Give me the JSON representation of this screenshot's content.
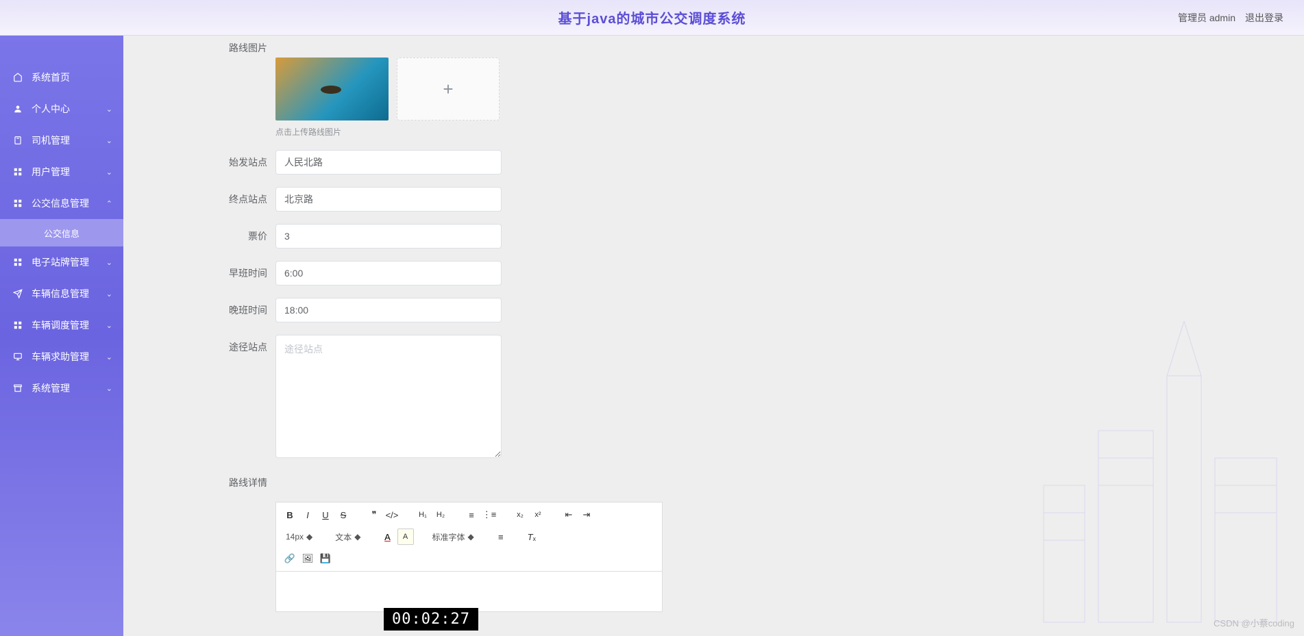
{
  "header": {
    "title": "基于java的城市公交调度系统",
    "role_label": "管理员 admin",
    "logout_label": "退出登录"
  },
  "sidebar": {
    "items": [
      {
        "icon": "home",
        "label": "系统首页",
        "expandable": false
      },
      {
        "icon": "person",
        "label": "个人中心",
        "expandable": true
      },
      {
        "icon": "clipboard",
        "label": "司机管理",
        "expandable": true
      },
      {
        "icon": "grid",
        "label": "用户管理",
        "expandable": true
      },
      {
        "icon": "grid",
        "label": "公交信息管理",
        "expandable": true,
        "expanded": true,
        "sub": [
          "公交信息"
        ]
      },
      {
        "icon": "grid",
        "label": "电子站牌管理",
        "expandable": true
      },
      {
        "icon": "send",
        "label": "车辆信息管理",
        "expandable": true
      },
      {
        "icon": "grid",
        "label": "车辆调度管理",
        "expandable": true
      },
      {
        "icon": "monitor",
        "label": "车辆求助管理",
        "expandable": true
      },
      {
        "icon": "archive",
        "label": "系统管理",
        "expandable": true
      }
    ]
  },
  "form": {
    "route_image_label": "路线图片",
    "upload_hint": "点击上传路线图片",
    "start_station": {
      "label": "始发站点",
      "value": "人民北路"
    },
    "end_station": {
      "label": "终点站点",
      "value": "北京路"
    },
    "price": {
      "label": "票价",
      "value": "3"
    },
    "early_time": {
      "label": "早班时间",
      "value": "6:00"
    },
    "late_time": {
      "label": "晚班时间",
      "value": "18:00"
    },
    "via_stations": {
      "label": "途径站点",
      "placeholder": "途径站点",
      "value": ""
    },
    "route_detail_label": "路线详情"
  },
  "editor": {
    "font_size": "14px",
    "text_label": "文本",
    "font_family": "标准字体"
  },
  "overlay": {
    "timestamp": "00:02:27",
    "watermark": "CSDN @小蔡coding"
  }
}
